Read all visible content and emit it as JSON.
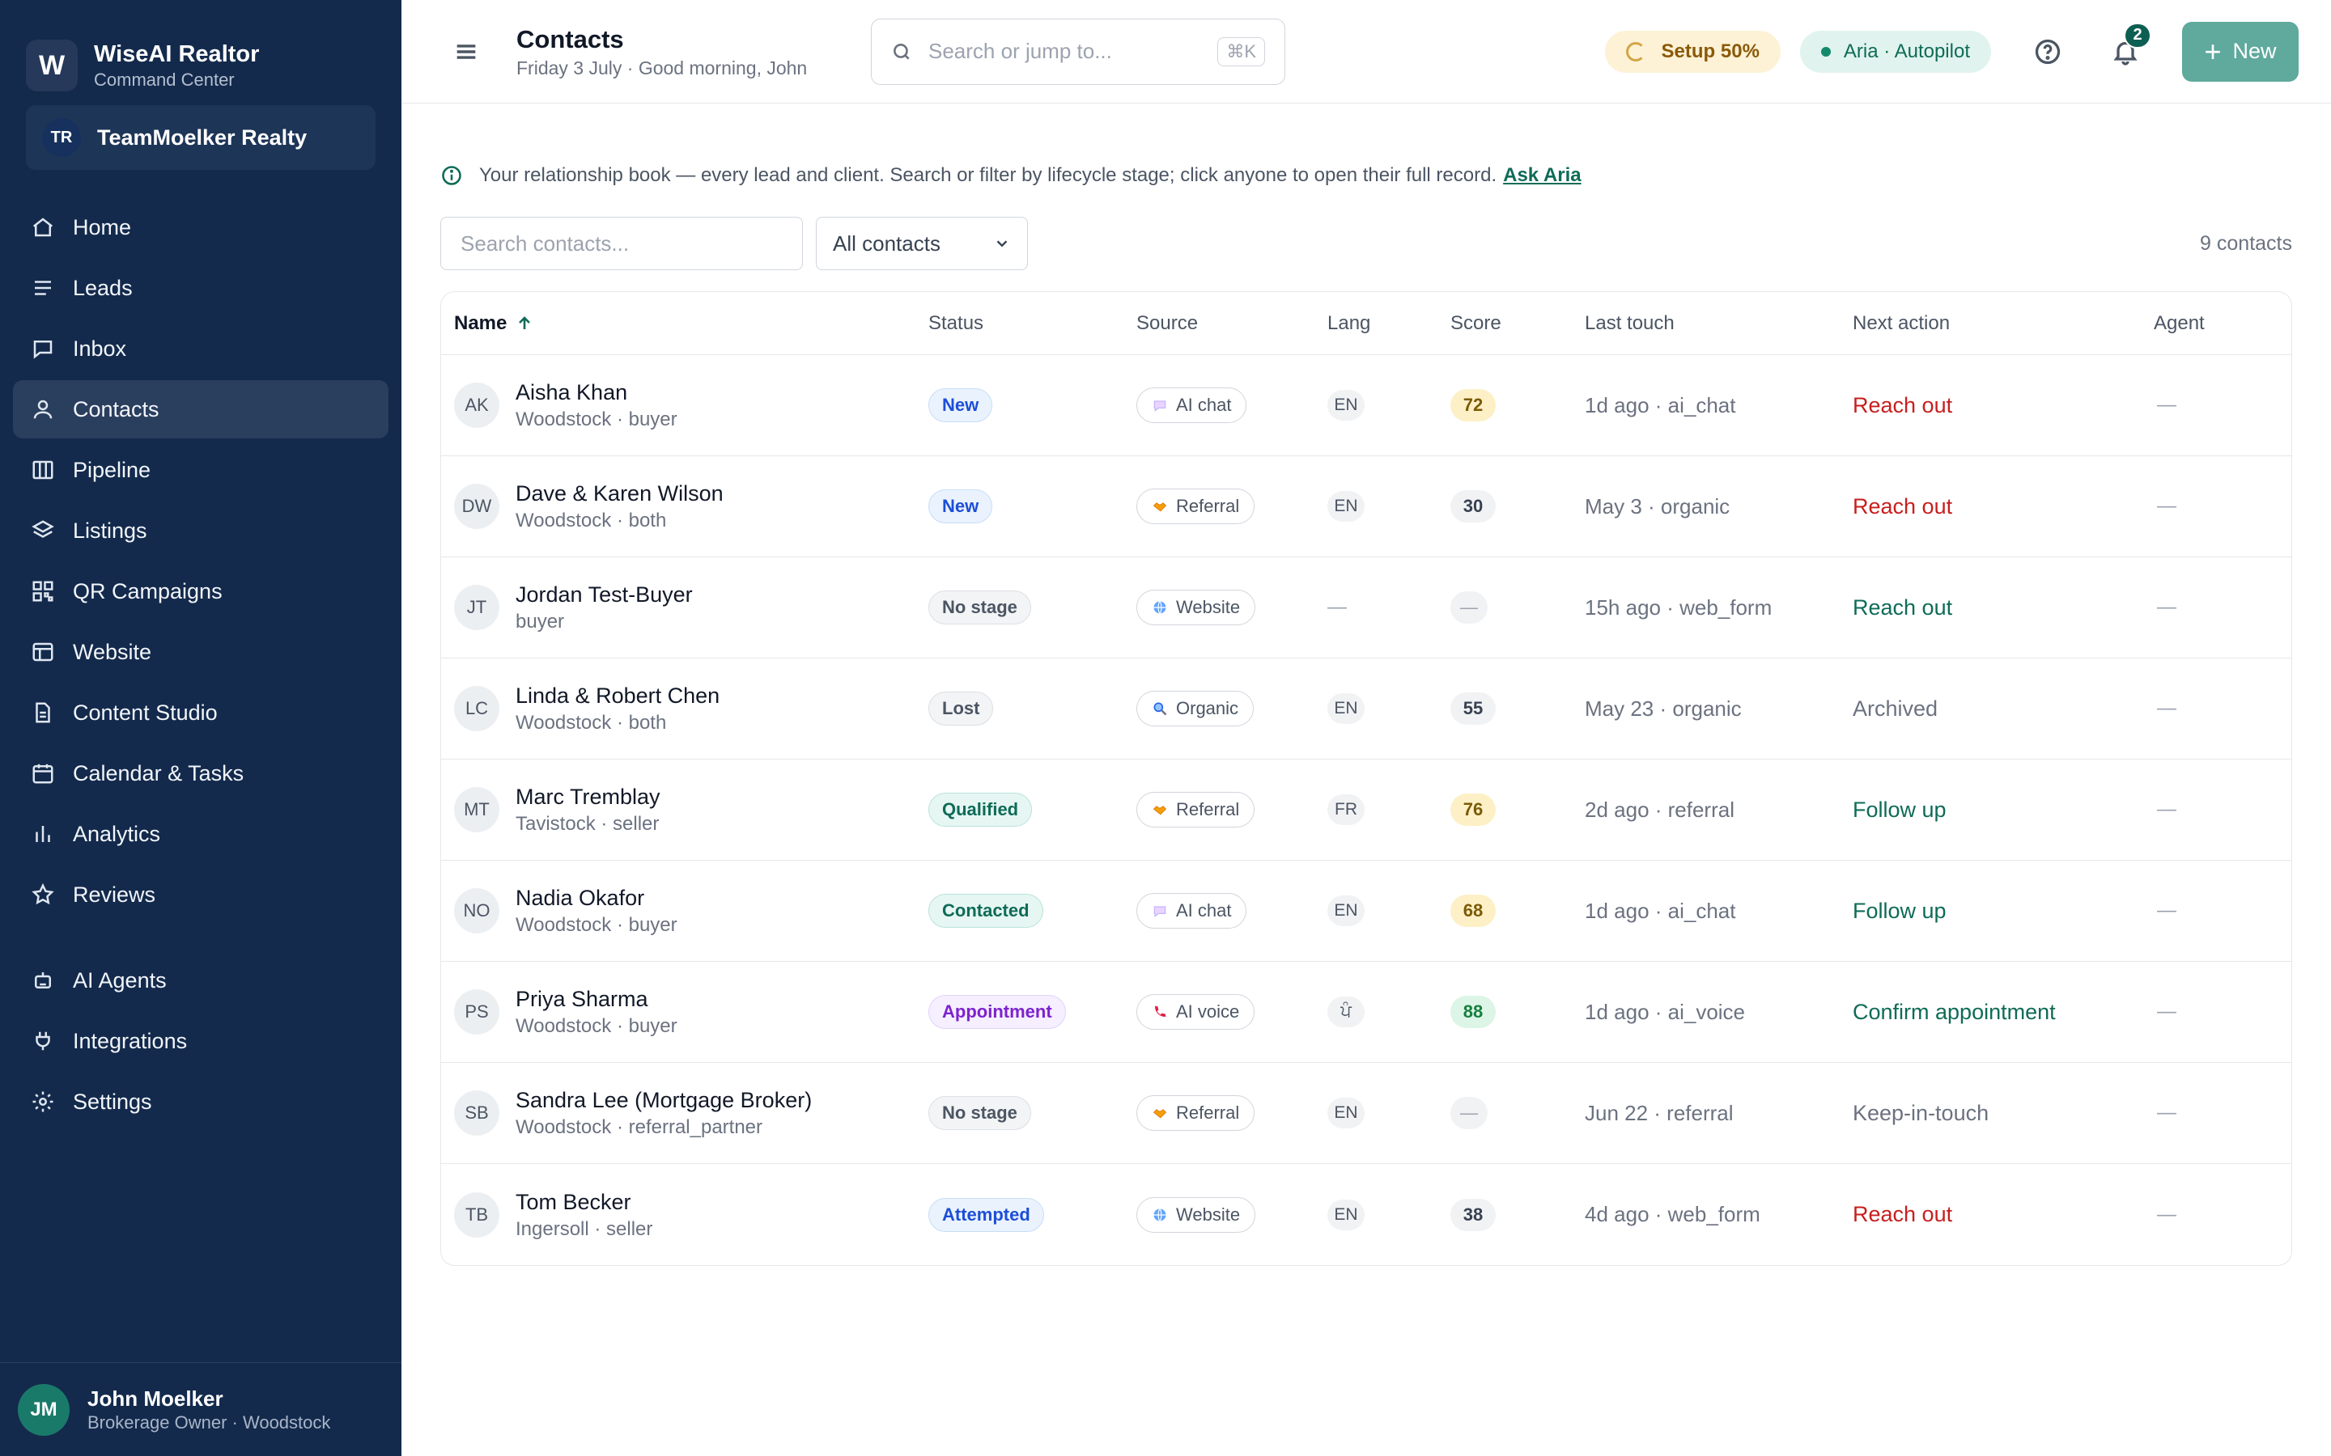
{
  "brand": {
    "logo": "W",
    "title": "WiseAI Realtor",
    "subtitle": "Command Center"
  },
  "workspace": {
    "initials": "TR",
    "name": "TeamMoelker Realty"
  },
  "nav": [
    {
      "label": "Home",
      "icon": "home-icon"
    },
    {
      "label": "Leads",
      "icon": "list-icon"
    },
    {
      "label": "Inbox",
      "icon": "chat-icon"
    },
    {
      "label": "Contacts",
      "icon": "user-icon",
      "active": true
    },
    {
      "label": "Pipeline",
      "icon": "columns-icon"
    },
    {
      "label": "Listings",
      "icon": "layers-icon"
    },
    {
      "label": "QR Campaigns",
      "icon": "qr-icon"
    },
    {
      "label": "Website",
      "icon": "browser-icon"
    },
    {
      "label": "Content Studio",
      "icon": "document-icon"
    },
    {
      "label": "Calendar & Tasks",
      "icon": "calendar-icon"
    },
    {
      "label": "Analytics",
      "icon": "bar-chart-icon"
    },
    {
      "label": "Reviews",
      "icon": "star-icon"
    }
  ],
  "nav2": [
    {
      "label": "AI Agents",
      "icon": "robot-icon"
    },
    {
      "label": "Integrations",
      "icon": "plug-icon"
    },
    {
      "label": "Settings",
      "icon": "gear-icon"
    }
  ],
  "user": {
    "initials": "JM",
    "name": "John Moelker",
    "role": "Brokerage Owner · Woodstock"
  },
  "header": {
    "title": "Contacts",
    "subtitle": "Friday 3 July · Good morning, John",
    "search_placeholder": "Search or jump to...",
    "shortcut": "⌘K",
    "setup": "Setup 50%",
    "setup_progress": 0.5,
    "aria": "Aria · Autopilot",
    "notifications": "2",
    "new_label": "New"
  },
  "info": {
    "text": "Your relationship book — every lead and client. Search or filter by lifecycle stage; click anyone to open their full record.",
    "link": "Ask Aria"
  },
  "filters": {
    "search_placeholder": "Search contacts...",
    "select_value": "All contacts",
    "count": "9 contacts"
  },
  "columns": [
    "Name",
    "Status",
    "Source",
    "Lang",
    "Score",
    "Last touch",
    "Next action",
    "Agent"
  ],
  "rows": [
    {
      "initials": "AK",
      "name": "Aisha Khan",
      "sub": "Woodstock · buyer",
      "status": "New",
      "status_style": "blue",
      "source": "AI chat",
      "source_icon": "chat-bubble-icon",
      "lang": "EN",
      "score": "72",
      "score_style": "amber",
      "last": "1d ago · ai_chat",
      "next": "Reach out",
      "next_style": "red",
      "agent": "—"
    },
    {
      "initials": "DW",
      "name": "Dave & Karen Wilson",
      "sub": "Woodstock · both",
      "status": "New",
      "status_style": "blue",
      "source": "Referral",
      "source_icon": "handshake-icon",
      "lang": "EN",
      "score": "30",
      "score_style": "gray",
      "last": "May 3 · organic",
      "next": "Reach out",
      "next_style": "red",
      "agent": "—"
    },
    {
      "initials": "JT",
      "name": "Jordan Test-Buyer",
      "sub": "buyer",
      "status": "No stage",
      "status_style": "gray",
      "source": "Website",
      "source_icon": "globe-icon",
      "lang": "—",
      "score": "—",
      "score_style": "gray",
      "last": "15h ago · web_form",
      "next": "Reach out",
      "next_style": "green",
      "agent": "—"
    },
    {
      "initials": "LC",
      "name": "Linda & Robert Chen",
      "sub": "Woodstock · both",
      "status": "Lost",
      "status_style": "gray",
      "source": "Organic",
      "source_icon": "magnifier-icon",
      "lang": "EN",
      "score": "55",
      "score_style": "gray",
      "last": "May 23 · organic",
      "next": "Archived",
      "next_style": "muted",
      "agent": "—"
    },
    {
      "initials": "MT",
      "name": "Marc Tremblay",
      "sub": "Tavistock · seller",
      "status": "Qualified",
      "status_style": "teal",
      "source": "Referral",
      "source_icon": "handshake-icon",
      "lang": "FR",
      "score": "76",
      "score_style": "amber",
      "last": "2d ago · referral",
      "next": "Follow up",
      "next_style": "green",
      "agent": "—"
    },
    {
      "initials": "NO",
      "name": "Nadia Okafor",
      "sub": "Woodstock · buyer",
      "status": "Contacted",
      "status_style": "teal",
      "source": "AI chat",
      "source_icon": "chat-bubble-icon",
      "lang": "EN",
      "score": "68",
      "score_style": "amber",
      "last": "1d ago · ai_chat",
      "next": "Follow up",
      "next_style": "green",
      "agent": "—"
    },
    {
      "initials": "PS",
      "name": "Priya Sharma",
      "sub": "Woodstock · buyer",
      "status": "Appointment",
      "status_style": "purple",
      "source": "AI voice",
      "source_icon": "phone-icon",
      "lang": "ਪੰ",
      "score": "88",
      "score_style": "green",
      "last": "1d ago · ai_voice",
      "next": "Confirm appointment",
      "next_style": "green",
      "agent": "—"
    },
    {
      "initials": "SB",
      "name": "Sandra Lee (Mortgage Broker)",
      "sub": "Woodstock · referral_partner",
      "status": "No stage",
      "status_style": "gray",
      "source": "Referral",
      "source_icon": "handshake-icon",
      "lang": "EN",
      "score": "—",
      "score_style": "gray",
      "last": "Jun 22 · referral",
      "next": "Keep-in-touch",
      "next_style": "muted",
      "agent": "—"
    },
    {
      "initials": "TB",
      "name": "Tom Becker",
      "sub": "Ingersoll · seller",
      "status": "Attempted",
      "status_style": "blue",
      "source": "Website",
      "source_icon": "globe-icon",
      "lang": "EN",
      "score": "38",
      "score_style": "gray",
      "last": "4d ago · web_form",
      "next": "Reach out",
      "next_style": "red",
      "agent": "—"
    }
  ]
}
